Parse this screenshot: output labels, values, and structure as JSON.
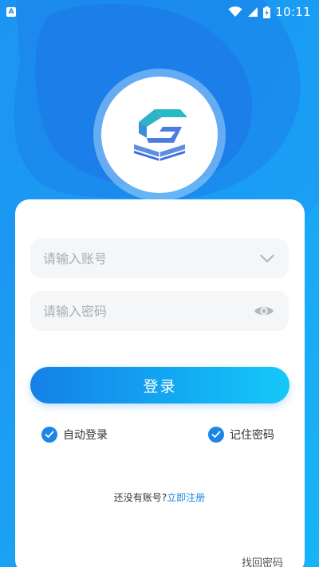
{
  "status_bar": {
    "notification_icon": "A",
    "time": "10:11",
    "icons": [
      "app-notification-icon",
      "wifi-icon",
      "cellular-signal-icon",
      "battery-charging-icon"
    ]
  },
  "logo": {
    "icon": "book-logo-icon",
    "colors": [
      "#26b8c8",
      "#4a7de2",
      "#3b6fd9"
    ]
  },
  "login_form": {
    "account": {
      "placeholder": "请输入账号",
      "value": ""
    },
    "password": {
      "placeholder": "请输入密码",
      "value": ""
    },
    "login_label": "登录",
    "auto_login": {
      "label": "自动登录",
      "checked": true
    },
    "remember_password": {
      "label": "记住密码",
      "checked": true
    },
    "register_prompt": "还没有账号?",
    "register_link": "立即注册",
    "forgot_password": "找回密码"
  },
  "colors": {
    "background": "#1aa8f5",
    "accent": "#1c86e6",
    "button_gradient": [
      "#1580e8",
      "#16c8f8"
    ],
    "field_background": "#f5f6f8"
  }
}
